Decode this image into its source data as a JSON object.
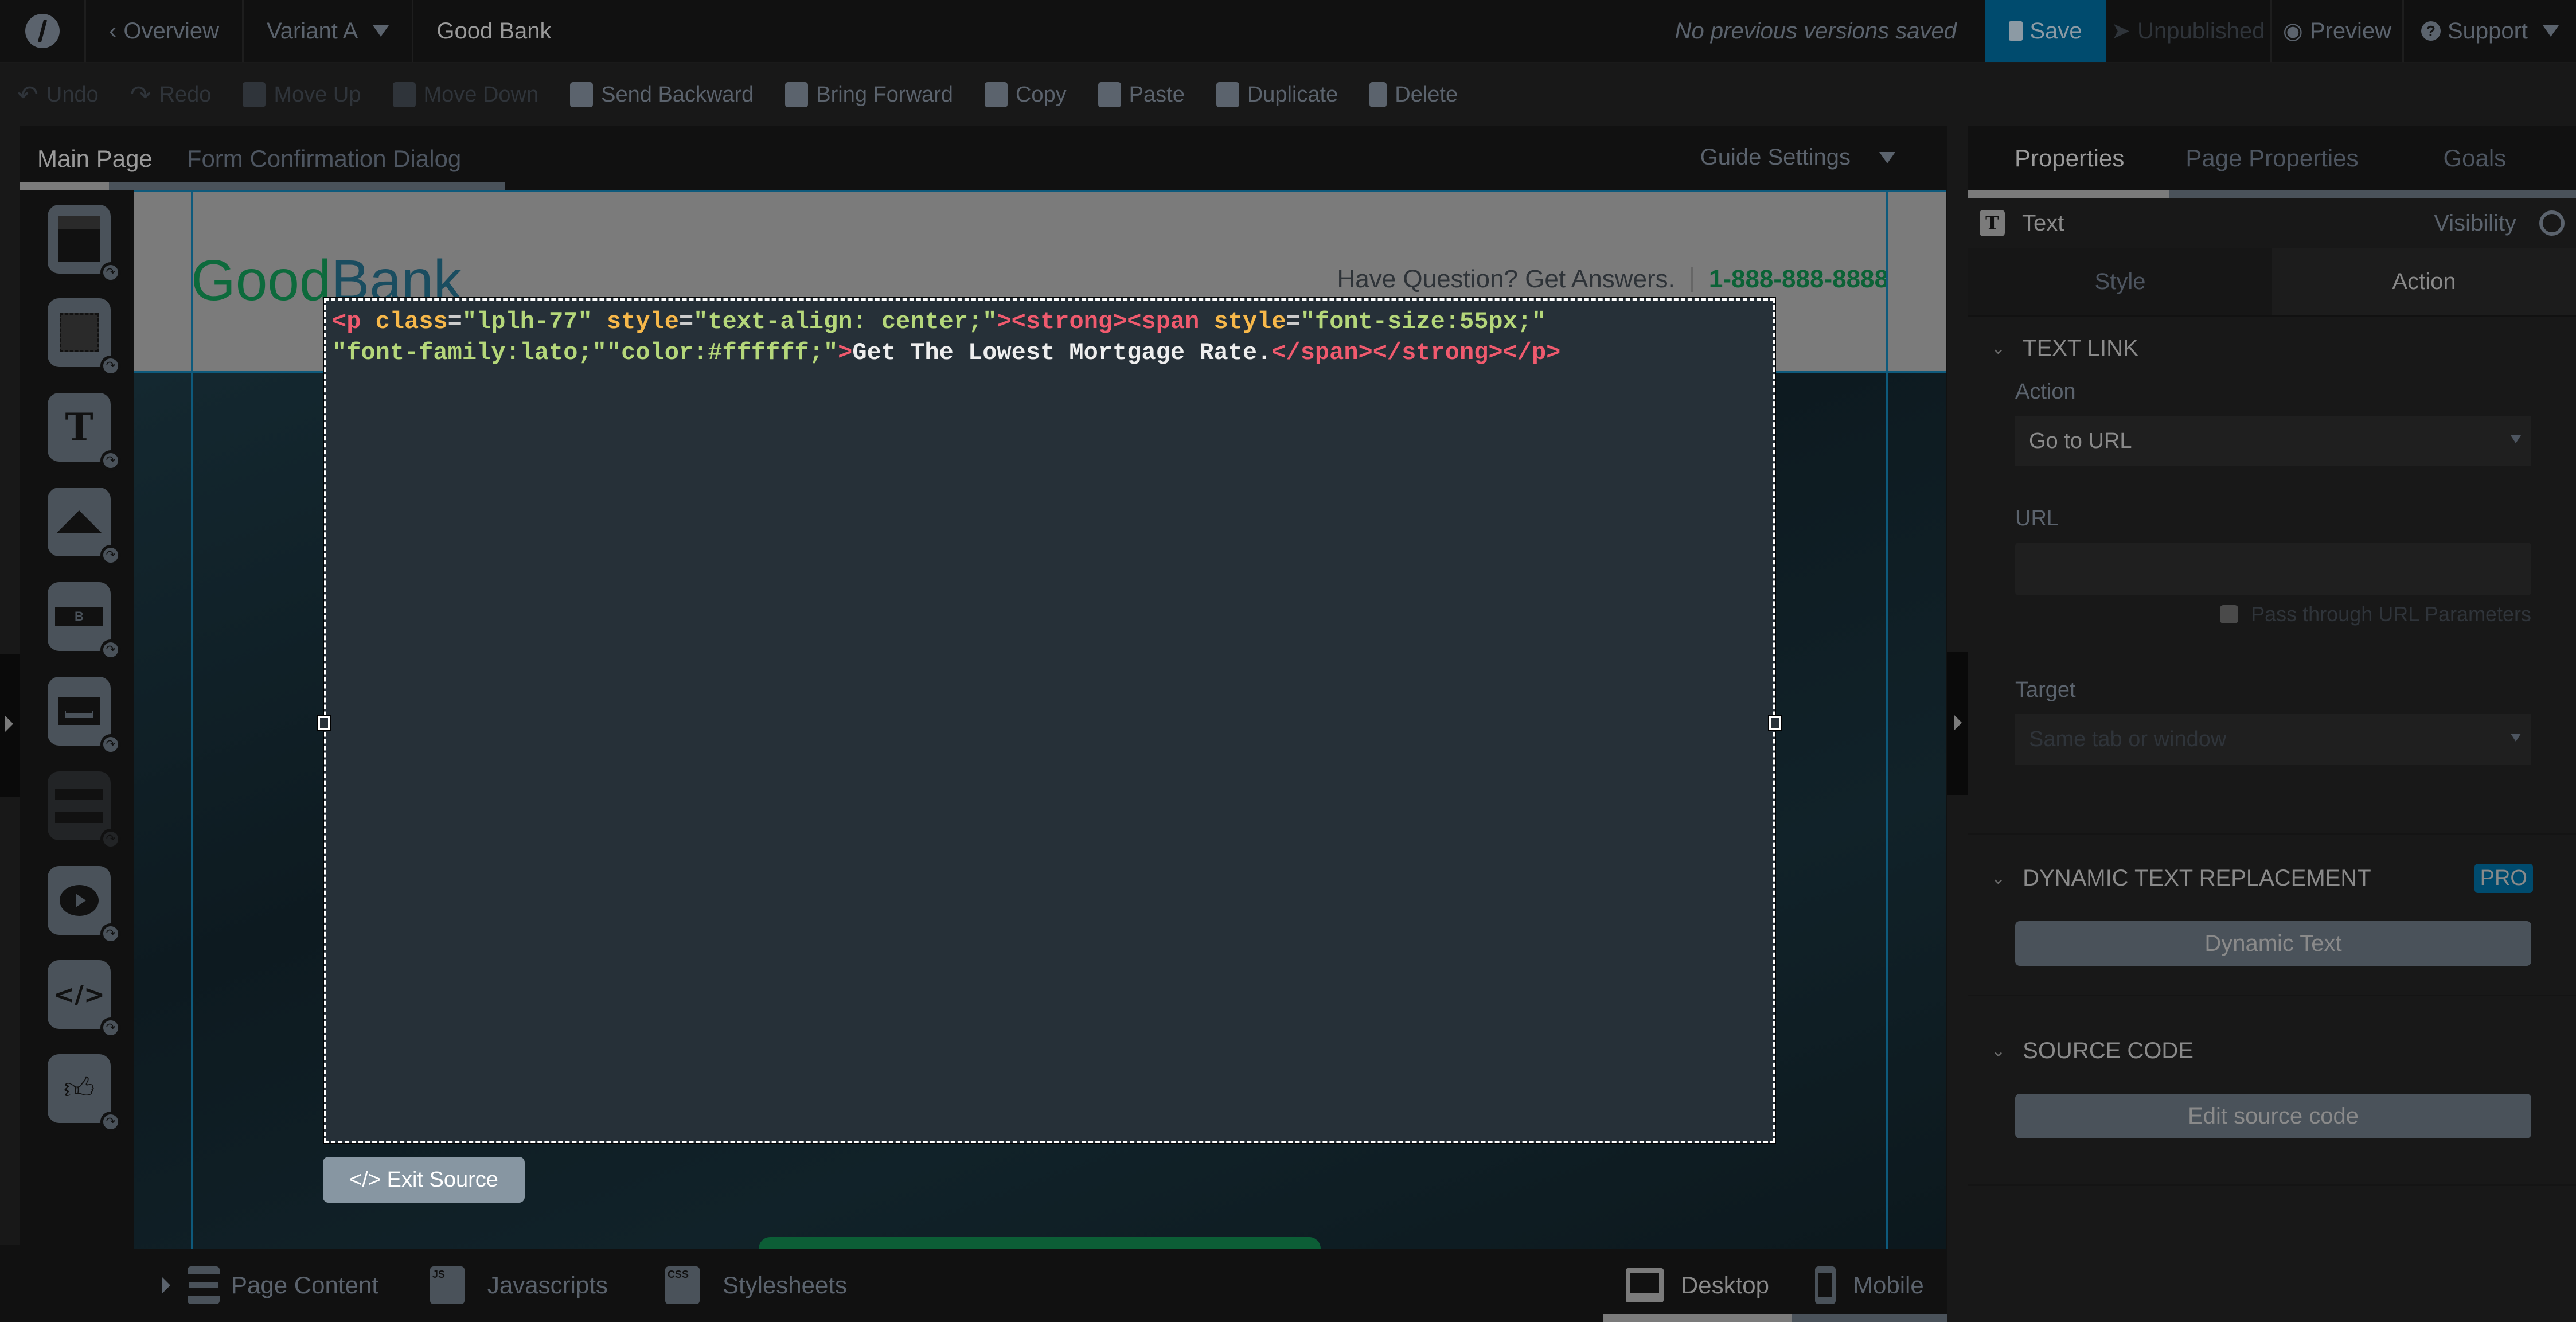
{
  "topbar": {
    "back_label": "Overview",
    "variant_label": "Variant A",
    "page_title": "Good Bank",
    "version_status": "No previous versions saved",
    "save_label": "Save",
    "unpublished_label": "Unpublished",
    "preview_label": "Preview",
    "support_label": "Support"
  },
  "toolbar": {
    "items": [
      {
        "label": "Undo",
        "icon": "undo-icon",
        "enabled": false
      },
      {
        "label": "Redo",
        "icon": "redo-icon",
        "enabled": false
      },
      {
        "label": "Move Up",
        "icon": "move-up-icon",
        "enabled": false
      },
      {
        "label": "Move Down",
        "icon": "move-down-icon",
        "enabled": false
      },
      {
        "label": "Send Backward",
        "icon": "send-backward-icon",
        "enabled": true
      },
      {
        "label": "Bring Forward",
        "icon": "bring-forward-icon",
        "enabled": true
      },
      {
        "label": "Copy",
        "icon": "copy-icon",
        "enabled": true
      },
      {
        "label": "Paste",
        "icon": "paste-icon",
        "enabled": true
      },
      {
        "label": "Duplicate",
        "icon": "duplicate-icon",
        "enabled": true
      },
      {
        "label": "Delete",
        "icon": "trash-icon",
        "enabled": true
      }
    ]
  },
  "page_tabs": {
    "tabs": [
      "Main Page",
      "Form Confirmation Dialog"
    ],
    "active": "Main Page",
    "guide_settings_label": "Guide Settings"
  },
  "widgets": [
    "section-icon",
    "box-icon",
    "text-icon",
    "image-icon",
    "button-icon",
    "lightbox-icon",
    "form-icon",
    "video-icon",
    "custom-html-icon",
    "social-widget-icon"
  ],
  "canvas": {
    "logo_good": "Good",
    "logo_bank": "Bank",
    "contact_text": "Have Question? Get Answers.",
    "phone": "1-888-888-8888",
    "source": {
      "line1": [
        {
          "t": "tag",
          "v": "<p "
        },
        {
          "t": "attr",
          "v": "class"
        },
        {
          "t": "eq",
          "v": "="
        },
        {
          "t": "str",
          "v": "\"lplh-77\" "
        },
        {
          "t": "attr",
          "v": "style"
        },
        {
          "t": "eq",
          "v": "="
        },
        {
          "t": "str",
          "v": "\"text-align: center;\""
        },
        {
          "t": "tag",
          "v": "><strong><span "
        },
        {
          "t": "attr",
          "v": "style"
        },
        {
          "t": "eq",
          "v": "="
        },
        {
          "t": "str",
          "v": "\"font-size:55px;\""
        }
      ],
      "line2": [
        {
          "t": "str",
          "v": "\"font-family:lato;\"\"color:#ffffff;\""
        },
        {
          "t": "tag",
          "v": ">"
        },
        {
          "t": "text",
          "v": "Get The Lowest Mortgage Rate."
        },
        {
          "t": "tag",
          "v": "</span></strong></p>"
        }
      ]
    },
    "exit_source_label": "</> Exit Source"
  },
  "bottombar": {
    "page_content_label": "Page Content",
    "javascripts_label": "Javascripts",
    "js_badge": "JS",
    "stylesheets_label": "Stylesheets",
    "css_badge": "CSS",
    "desktop_label": "Desktop",
    "mobile_label": "Mobile",
    "active_device": "Desktop"
  },
  "properties_panel": {
    "tabs": [
      "Properties",
      "Page Properties",
      "Goals"
    ],
    "active_tab": "Properties",
    "element_type": "Text",
    "element_icon_glyph": "T",
    "visibility_label": "Visibility",
    "subtabs": [
      "Style",
      "Action"
    ],
    "active_subtab": "Action",
    "text_link": {
      "title": "TEXT LINK",
      "action_label": "Action",
      "action_value": "Go to URL",
      "url_label": "URL",
      "url_value": "",
      "pass_through_label": "Pass through URL Parameters",
      "pass_through_checked": false,
      "target_label": "Target",
      "target_value": "Same tab or window"
    },
    "dynamic_text": {
      "title": "DYNAMIC TEXT REPLACEMENT",
      "badge": "PRO",
      "button_label": "Dynamic Text"
    },
    "source_code": {
      "title": "SOURCE CODE",
      "button_label": "Edit source code"
    }
  },
  "colors": {
    "save_bg": "#004b6e",
    "pro_badge": "#004b6e",
    "logo_good": "#0d6a3c",
    "phone": "#0b6236",
    "code_tag": "#f05a6e",
    "code_attr": "#f7b84a",
    "code_string": "#b5d77a"
  }
}
